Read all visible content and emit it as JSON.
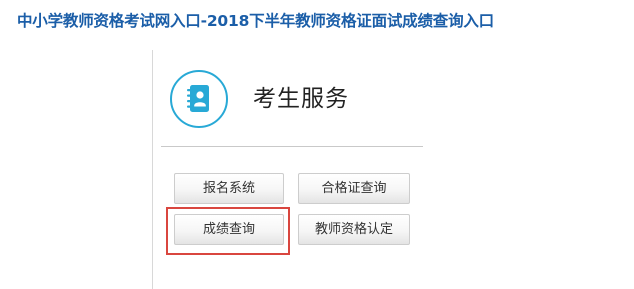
{
  "page": {
    "title": "中小学教师资格考试网入口-2018下半年教师资格证面试成绩查询入口"
  },
  "service": {
    "title": "考生服务",
    "icon": "address-book-icon",
    "accent_color": "#28a9d6",
    "buttons": [
      {
        "label": "报名系统"
      },
      {
        "label": "合格证查询"
      },
      {
        "label": "成绩查询",
        "highlighted": true
      },
      {
        "label": "教师资格认定"
      }
    ],
    "highlight_color": "#d9463f"
  }
}
